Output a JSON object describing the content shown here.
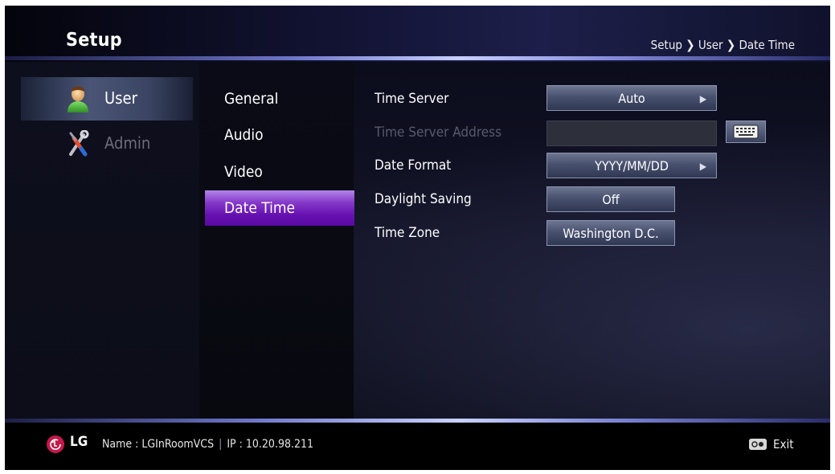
{
  "header": {
    "title": "Setup",
    "breadcrumb": "Setup ❯ User ❯ Date Time"
  },
  "user_menu": [
    {
      "label": "User",
      "icon": "user-icon",
      "selected": true
    },
    {
      "label": "Admin",
      "icon": "tools-icon",
      "selected": false
    }
  ],
  "submenu": [
    {
      "label": "General",
      "selected": false
    },
    {
      "label": "Audio",
      "selected": false
    },
    {
      "label": "Video",
      "selected": false
    },
    {
      "label": "Date Time",
      "selected": true
    }
  ],
  "settings": {
    "time_server": {
      "label": "Time Server",
      "value": "Auto"
    },
    "time_server_address": {
      "label": "Time Server Address",
      "value": "",
      "disabled": true
    },
    "date_format": {
      "label": "Date Format",
      "value": "YYYY/MM/DD"
    },
    "daylight_saving": {
      "label": "Daylight Saving",
      "value": "Off"
    },
    "time_zone": {
      "label": "Time Zone",
      "value": "Washington D.C."
    }
  },
  "footer": {
    "brand": "LG",
    "status": "Name : LGInRoomVCS",
    "ip": "IP : 10.20.98.211",
    "exit_label": "Exit"
  },
  "colors": {
    "accent_purple": "#7a2ec7",
    "button_face": "#48516e",
    "lg_red": "#c4194a"
  }
}
